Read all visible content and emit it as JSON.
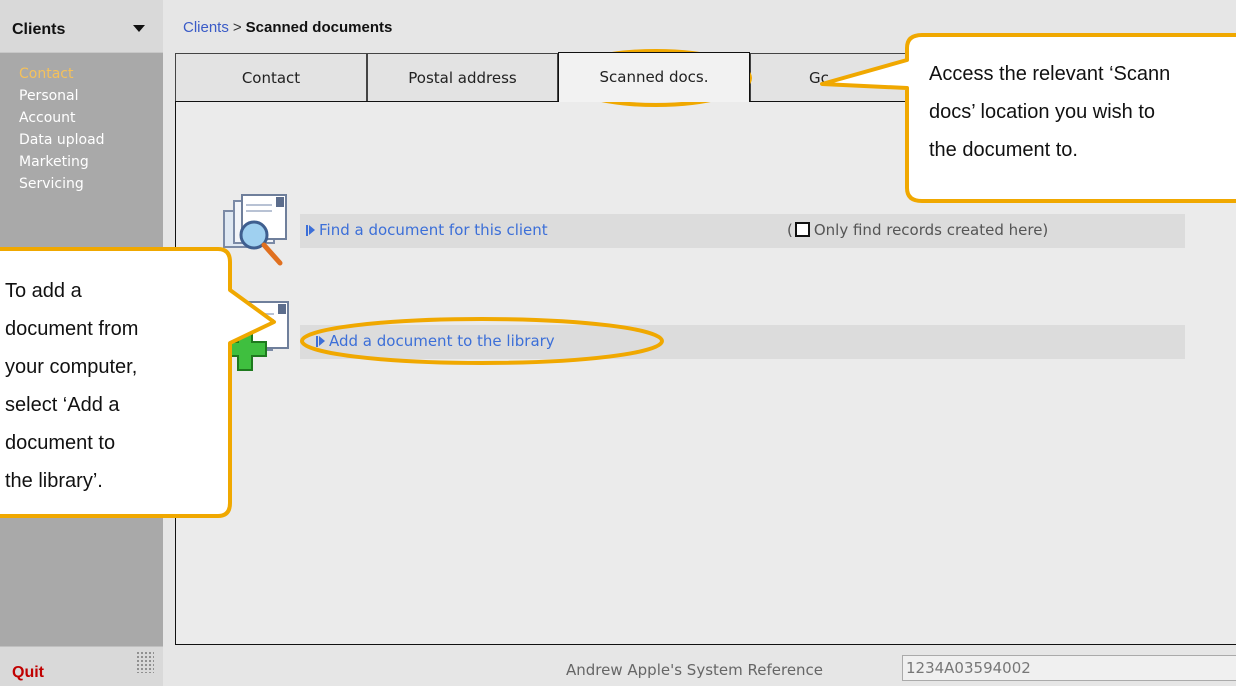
{
  "sidebar": {
    "title": "Clients",
    "items": [
      {
        "label": "Contact",
        "active": true
      },
      {
        "label": "Personal"
      },
      {
        "label": "Account"
      },
      {
        "label": "Data upload"
      },
      {
        "label": "Marketing"
      },
      {
        "label": "Servicing"
      }
    ],
    "quit_label": "Quit"
  },
  "breadcrumb": {
    "root": "Clients",
    "separator": ">",
    "current": "Scanned documents"
  },
  "tabs": [
    {
      "label": "Contact"
    },
    {
      "label": "Postal address"
    },
    {
      "label": "Scanned docs.",
      "active": true
    },
    {
      "label": "Gc"
    }
  ],
  "actions": {
    "find_label": "Find a document for this client",
    "find_option_open": "(",
    "find_option_label": "Only find records created here)",
    "add_label": "Add a document to the library"
  },
  "footer": {
    "sysref_label": "Andrew Apple's System Reference",
    "sysref_value": "1234A03594002"
  },
  "callouts": {
    "tabs_note": [
      "Access the relevant ‘Scann",
      "docs’ location you wish to",
      "the document to."
    ],
    "add_note": [
      "To add a",
      "document from",
      "your computer,",
      "select ‘Add a",
      "document to",
      "the library’."
    ]
  },
  "colors": {
    "accent_highlight": "#f0a800",
    "link": "#3c6fd8",
    "quit": "#c00000",
    "active_nav": "#f5c15a"
  }
}
